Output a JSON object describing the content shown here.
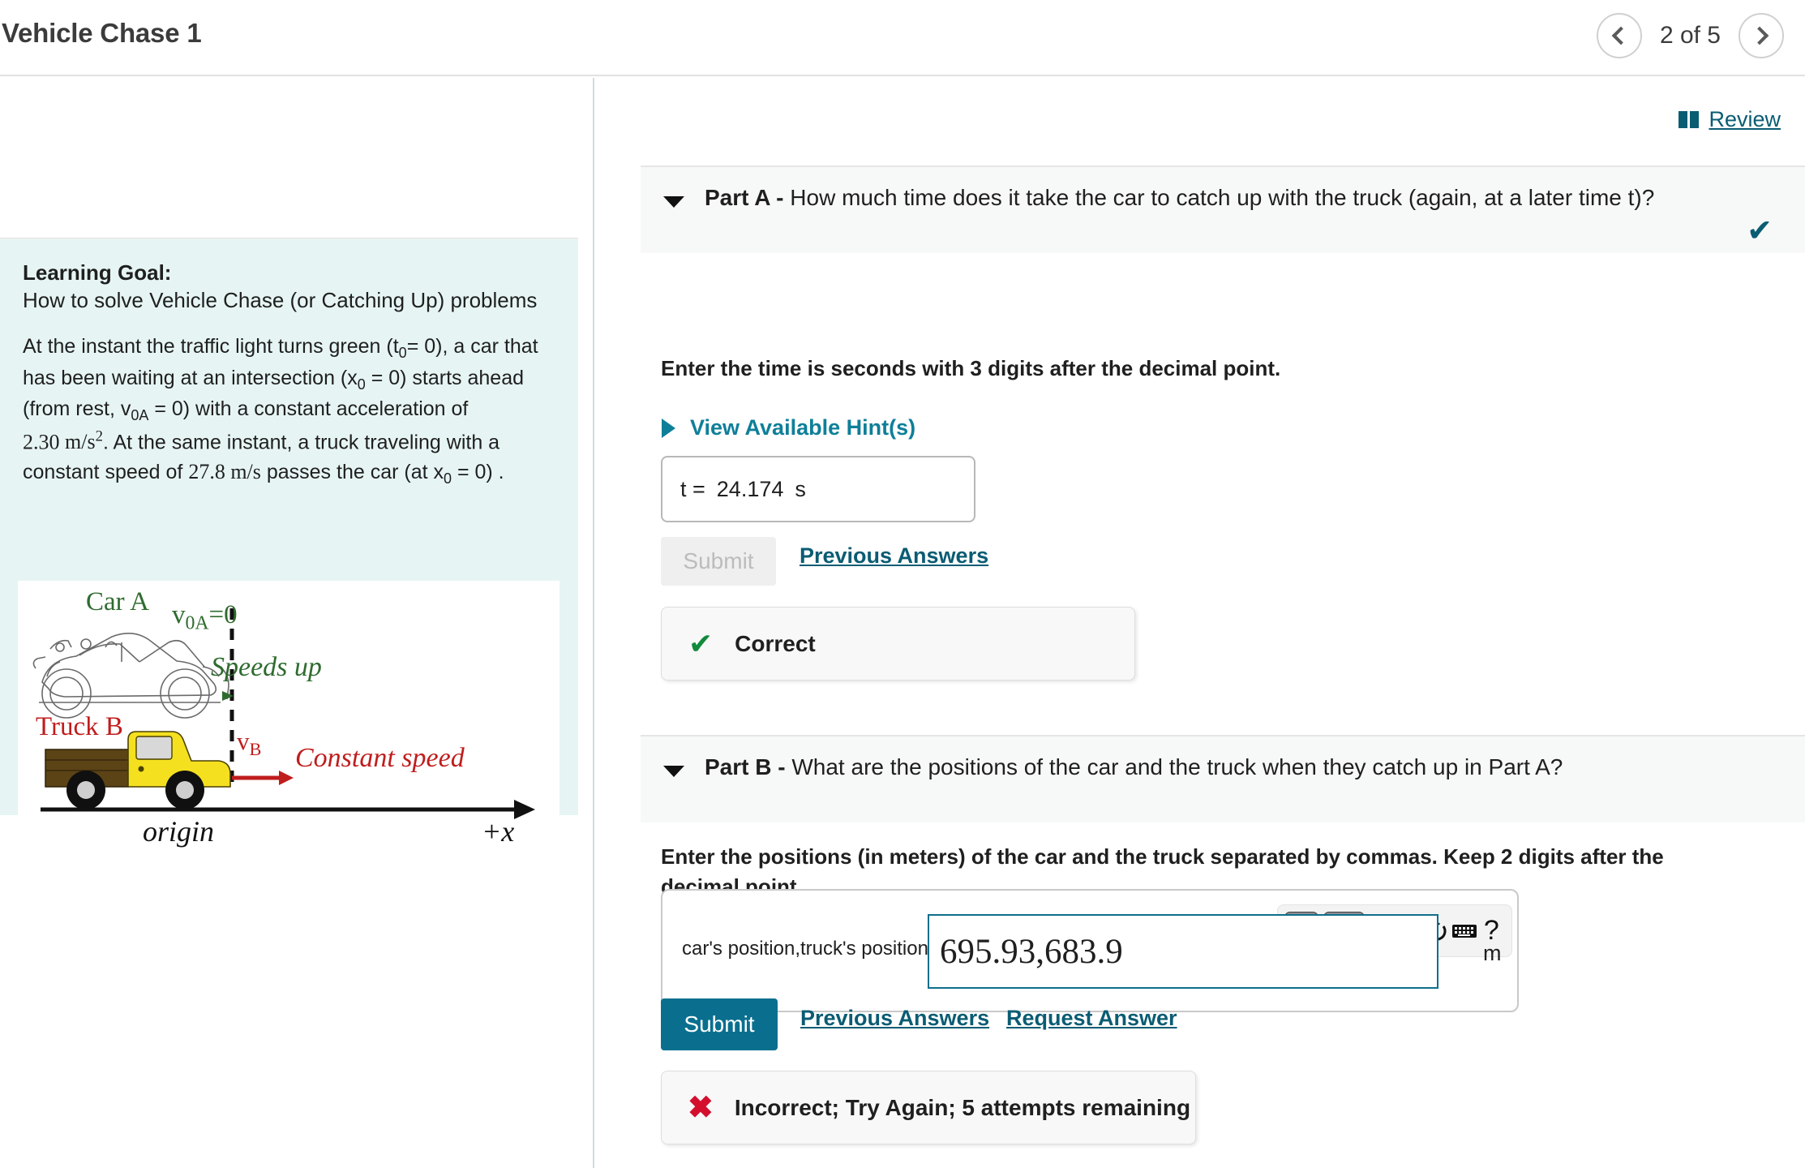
{
  "header": {
    "title": "Vehicle Chase 1",
    "pager_label": "2 of 5",
    "prev_icon": "chevron-left-icon",
    "next_icon": "chevron-right-icon"
  },
  "review": {
    "label": "Review",
    "icon": "book-icon",
    "color": "#0a5c73"
  },
  "sidebar": {
    "goal_heading": "Learning Goal:",
    "goal_subtitle": "How to solve Vehicle Chase (or Catching Up) problems",
    "body_line1": "At the instant the traffic light turns green (t",
    "body_t0_sub": "0",
    "body_line1b": "= 0), a car that has been waiting at an intersection (x",
    "body_x0_sub": "0",
    "body_line2": " = 0) starts ahead (from rest, v",
    "body_v0a_sub": "0A",
    "body_line3": " = 0) with a constant acceleration of ",
    "accel_value": "2.30",
    "accel_unit_num": "m",
    "accel_unit_den": "s",
    "accel_unit_exp": "2",
    "body_line4": ". At the same instant, a truck traveling with a constant speed of ",
    "speed_value": "27.8",
    "speed_unit": "m/s",
    "body_line5": " passes the car (at x",
    "body_x0_sub2": "0",
    "body_line6": " = 0) ."
  },
  "diagram": {
    "car_label": "Car A",
    "car_vel_label": "v",
    "car_vel_sub": "0A",
    "car_vel_eq": "=0",
    "car_note": "Speeds up",
    "truck_label": "Truck B",
    "truck_vel_label": "v",
    "truck_vel_sub": "B",
    "truck_note": "Constant speed",
    "origin_label": "origin",
    "axis_label": "+x",
    "car_color": "#2f6b2f",
    "truck_color": "#c01d1d",
    "truck_body_color": "#f5e020",
    "truck_bed_color": "#5c4316"
  },
  "partA": {
    "caret_icon": "caret-down-icon",
    "label": "Part A -",
    "question": "How much time does it take the car to catch up with the truck (again, at a later time t)?",
    "status_icon": "check-icon",
    "status_color": "#0a5c73",
    "prompt": "Enter the time is seconds with 3 digits after the decimal point.",
    "hints_label": "View Available Hint(s)",
    "hints_icon": "triangle-right-icon",
    "answer_prefix": "t =",
    "answer_value": "24.174",
    "answer_unit": "s",
    "submit_label": "Submit",
    "previous_answers_label": "Previous Answers",
    "feedback_icon": "check-icon",
    "feedback_text": "Correct",
    "feedback_color": "#128a3c"
  },
  "partB": {
    "caret_icon": "caret-down-icon",
    "label": "Part B -",
    "question": "What are the positions of the car and the truck when they catch up in Part A?",
    "prompt": "Enter the positions (in meters) of the car and the truck separated by commas. Keep 2 digits after the decimal point.",
    "toolbar": [
      {
        "name": "template-sqrt-button",
        "glyph": "√",
        "type": "button"
      },
      {
        "name": "greek-symbols-button",
        "glyph": "ΑΣφ",
        "type": "button"
      },
      {
        "name": "undo-icon",
        "glyph": "↶",
        "type": "icon"
      },
      {
        "name": "redo-icon",
        "glyph": "↷",
        "type": "icon"
      },
      {
        "name": "reset-icon",
        "glyph": "↻",
        "type": "icon"
      },
      {
        "name": "keyboard-icon",
        "glyph": "⌨",
        "type": "icon"
      },
      {
        "name": "help-icon",
        "glyph": "?",
        "type": "icon"
      }
    ],
    "field_label": "car's position,truck's position =",
    "field_value": "695.93,683.9",
    "field_unit": "m",
    "submit_label": "Submit",
    "previous_answers_label": "Previous Answers",
    "request_answer_label": "Request Answer",
    "feedback_icon": "x-icon",
    "feedback_text": "Incorrect; Try Again; 5 attempts remaining",
    "feedback_color": "#d40f2e"
  }
}
